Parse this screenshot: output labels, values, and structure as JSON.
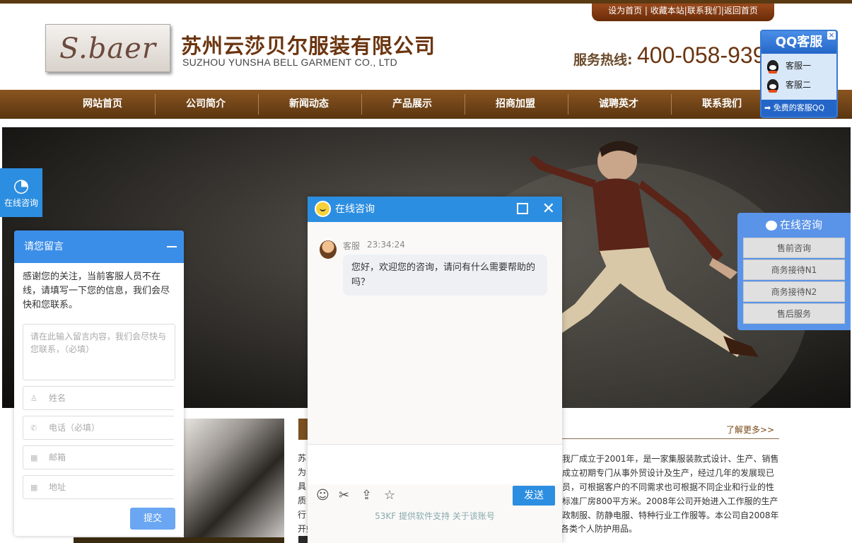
{
  "header": {
    "top_links": "设为首页 | 收藏本站|联系我们|返回首页",
    "logo_text": "S.baer",
    "company_cn": "苏州云莎贝尔服装有限公司",
    "company_en": "SUZHOU YUNSHA BELL GARMENT CO., LTD",
    "hotline_label": "服务热线:",
    "hotline_number": "400-058-939"
  },
  "nav": [
    "网站首页",
    "公司简介",
    "新闻动态",
    "产品展示",
    "招商加盟",
    "诚聘英才",
    "联系我们"
  ],
  "qq_service": {
    "title": "QQ客服",
    "items": [
      "客服一",
      "客服二"
    ],
    "footer": "免费的客服QQ"
  },
  "left_tab": {
    "label": "在线咨询"
  },
  "message_panel": {
    "title": "请您留言",
    "intro": "感谢您的关注，当前客服人员不在线，请填写一下您的信息，我们会尽快和您联系。",
    "content_placeholder": "请在此输入留言内容，我们会尽快与您联系，（必填）",
    "fields": [
      "姓名",
      "电话（必填）",
      "邮箱",
      "地址"
    ],
    "submit": "提交"
  },
  "chat": {
    "title": "在线咨询",
    "agent_name": "客服",
    "time": "23:34:24",
    "message": "您好，欢迎您的咨询，请问有什么需要帮助的吗？",
    "send": "发送",
    "footer": "53KF 提供软件支持   关于该账号"
  },
  "right_consult": {
    "title": "在线咨询",
    "items": [
      "售前咨询",
      "商务接待N1",
      "商务接待N2",
      "售后服务"
    ]
  },
  "about": {
    "more": "了解更多>>",
    "lines": [
      "我厂成立于2001年，是一家集服装款式设计、生产、销售",
      "成立初期专门从事外贸设计及生产，经过几年的发展现已",
      "员，可根据客户的不同需求也可根据不同企业和行业的性",
      "标准厂房800平方米。2008年公司开始进入工作服的生产",
      "政制服、防静电服、特种行业工作服等。本公司自2008年"
    ],
    "left_chars": [
      "苏",
      "为",
      "具",
      "质",
      "行"
    ],
    "last_line": "开始经销各类劳防用品及无尘室耗材等，主要有手套，安全帽，口罩等各类个人防护用品。"
  }
}
